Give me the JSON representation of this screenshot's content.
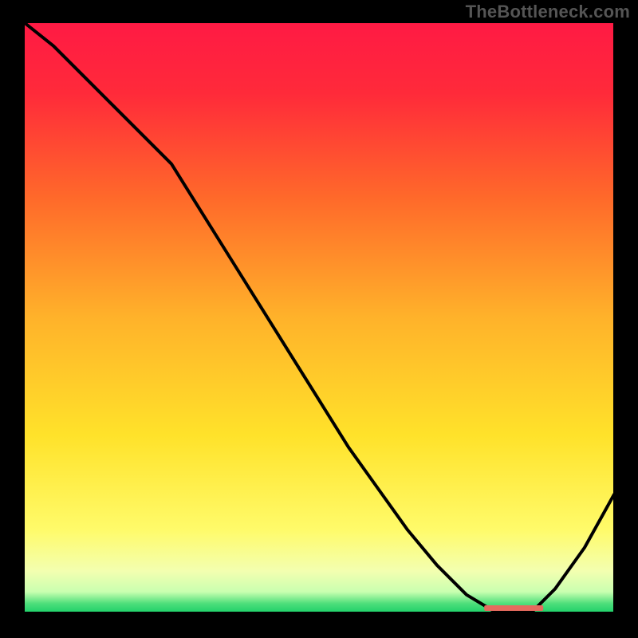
{
  "watermark": "TheBottleneck.com",
  "colors": {
    "curve": "#000000",
    "marker": "#e46a5e"
  },
  "chart_data": {
    "type": "line",
    "title": "",
    "xlabel": "",
    "ylabel": "",
    "xlim": [
      0,
      100
    ],
    "ylim": [
      0,
      100
    ],
    "x": [
      0,
      5,
      10,
      15,
      20,
      25,
      30,
      35,
      40,
      45,
      50,
      55,
      60,
      65,
      70,
      75,
      80,
      83,
      86,
      90,
      95,
      100
    ],
    "y": [
      100,
      96,
      91,
      86,
      81,
      76,
      68,
      60,
      52,
      44,
      36,
      28,
      21,
      14,
      8,
      3,
      0,
      0,
      0,
      4,
      11,
      20
    ],
    "baseline_marker_x": [
      78,
      88
    ]
  }
}
